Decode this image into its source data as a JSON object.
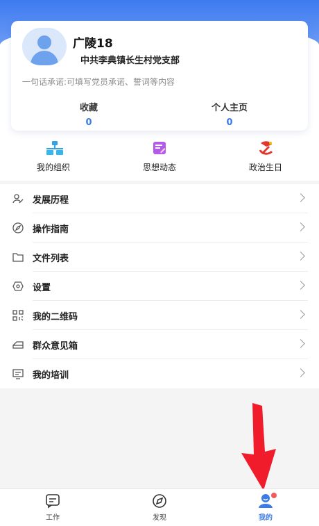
{
  "profile": {
    "name": "广陵18",
    "organization": "中共李典镇长生村党支部",
    "pledge_placeholder": "一句话承诺:可填写党员承诺、誓词等内容",
    "stats": [
      {
        "label": "收藏",
        "value": "0"
      },
      {
        "label": "个人主页",
        "value": "0"
      }
    ]
  },
  "shortcuts": [
    {
      "label": "我的组织",
      "icon": "organization-icon"
    },
    {
      "label": "思想动态",
      "icon": "thoughts-icon"
    },
    {
      "label": "政治生日",
      "icon": "party-emblem-icon"
    }
  ],
  "menu": [
    {
      "label": "发展历程",
      "icon": "person-edit-icon"
    },
    {
      "label": "操作指南",
      "icon": "compass-icon"
    },
    {
      "label": "文件列表",
      "icon": "folder-icon"
    },
    {
      "label": "设置",
      "icon": "settings-icon"
    },
    {
      "label": "我的二维码",
      "icon": "qr-code-icon"
    },
    {
      "label": "群众意见箱",
      "icon": "mailbox-icon"
    },
    {
      "label": "我的培训",
      "icon": "training-icon"
    }
  ],
  "tabbar": [
    {
      "label": "工作",
      "icon": "work-icon"
    },
    {
      "label": "发现",
      "icon": "discover-icon"
    },
    {
      "label": "我的",
      "icon": "mine-icon",
      "active": true,
      "badge": true
    }
  ],
  "colors": {
    "accent": "#3b7be9",
    "header_gradient_top": "#3e7bf0",
    "party_red": "#e0382e",
    "annotation_red": "#f01c2c"
  }
}
